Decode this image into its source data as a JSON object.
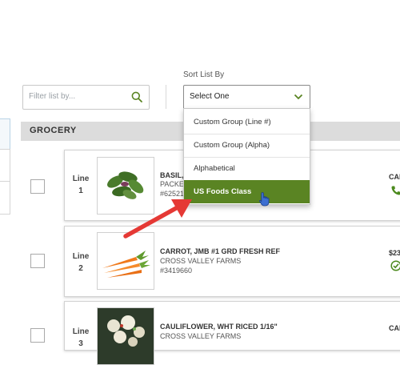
{
  "filter": {
    "placeholder": "Filter list by..."
  },
  "sort": {
    "label": "Sort List By",
    "selected": "Select One",
    "options": [
      "Custom Group (Line #)",
      "Custom Group (Alpha)",
      "Alphabetical",
      "US Foods Class"
    ],
    "highlighted": "US Foods Class"
  },
  "section": {
    "title": "GROCERY"
  },
  "rows": [
    {
      "line_label": "Line",
      "line_num": "1",
      "name": "BASIL,",
      "sub1": "PACKE",
      "sub2": "#62521",
      "right": "CAL"
    },
    {
      "line_label": "Line",
      "line_num": "2",
      "name": "CARROT, JMB #1 GRD FRESH REF",
      "sub1": "CROSS VALLEY FARMS",
      "sub2": "#3419660",
      "right": "$23"
    },
    {
      "line_label": "Line",
      "line_num": "3",
      "name": "CAULIFLOWER, WHT RICED 1/16\"",
      "sub1": "CROSS VALLEY FARMS",
      "sub2": "",
      "right": "CAL"
    }
  ],
  "colors": {
    "accent": "#5a8423",
    "arrow": "#e53935",
    "icon_green": "#4c8a1e"
  },
  "icons": [
    "search-icon",
    "chevron-down-icon",
    "phone-icon",
    "check-circle-icon",
    "hand-cursor-icon"
  ]
}
